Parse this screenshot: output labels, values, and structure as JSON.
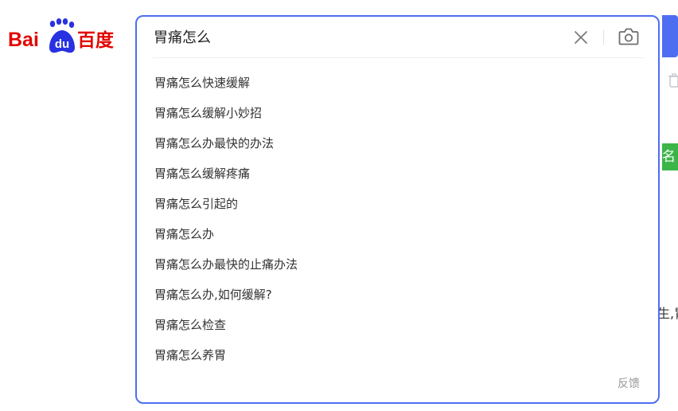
{
  "logo": {
    "text_bai": "Bai",
    "text_du": "du",
    "text_cn": "百度",
    "color_red": "#e10601",
    "color_blue": "#2932e1"
  },
  "search": {
    "query": "胃痛怎么",
    "accent_color": "#4e6ef2",
    "clear_icon": "close-icon",
    "camera_icon": "camera-icon"
  },
  "suggestions": [
    "胃痛怎么快速缓解",
    "胃痛怎么缓解小妙招",
    "胃痛怎么办最快的办法",
    "胃痛怎么缓解疼痛",
    "胃痛怎么引起的",
    "胃痛怎么办",
    "胃痛怎么办最快的止痛办法",
    "胃痛怎么办,如何缓解?",
    "胃痛怎么检查",
    "胃痛怎么养胃"
  ],
  "feedback_label": "反馈",
  "background": {
    "green_tag_text": "名",
    "fragment_text": "生,胃"
  }
}
